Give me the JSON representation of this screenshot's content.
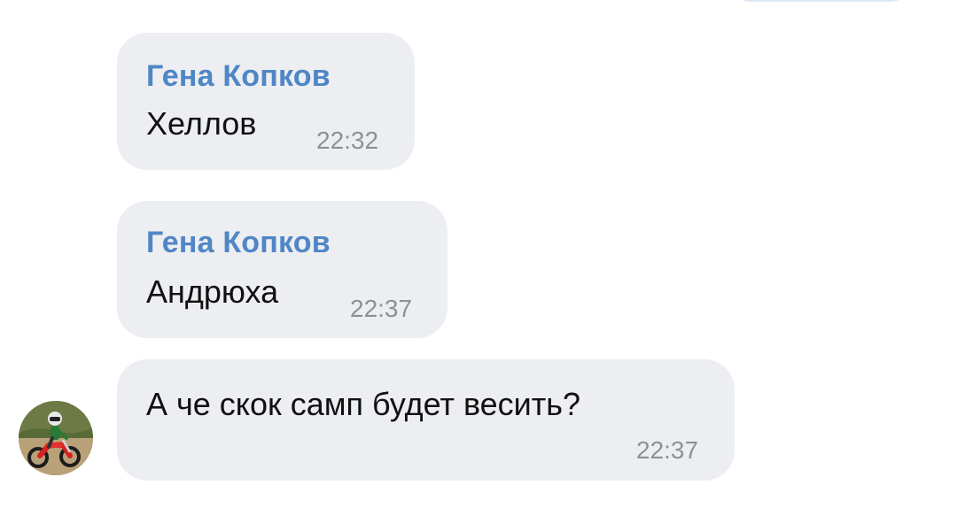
{
  "messages": [
    {
      "sender": "Гена Копков",
      "text": "Хеллов",
      "time": "22:32"
    },
    {
      "sender": "Гена Копков",
      "text": "Андрюха",
      "time": "22:37"
    },
    {
      "sender": "",
      "text": "А че скок самп будет весить?",
      "time": "22:37",
      "avatar_icon": "motocross-rider-avatar"
    }
  ],
  "colors": {
    "incoming_bubble": "#eceef1",
    "sender_name": "#4f86c6",
    "message_text": "#111111",
    "timestamp": "#8d9196",
    "outgoing_bubble": "#dbe9f7"
  }
}
